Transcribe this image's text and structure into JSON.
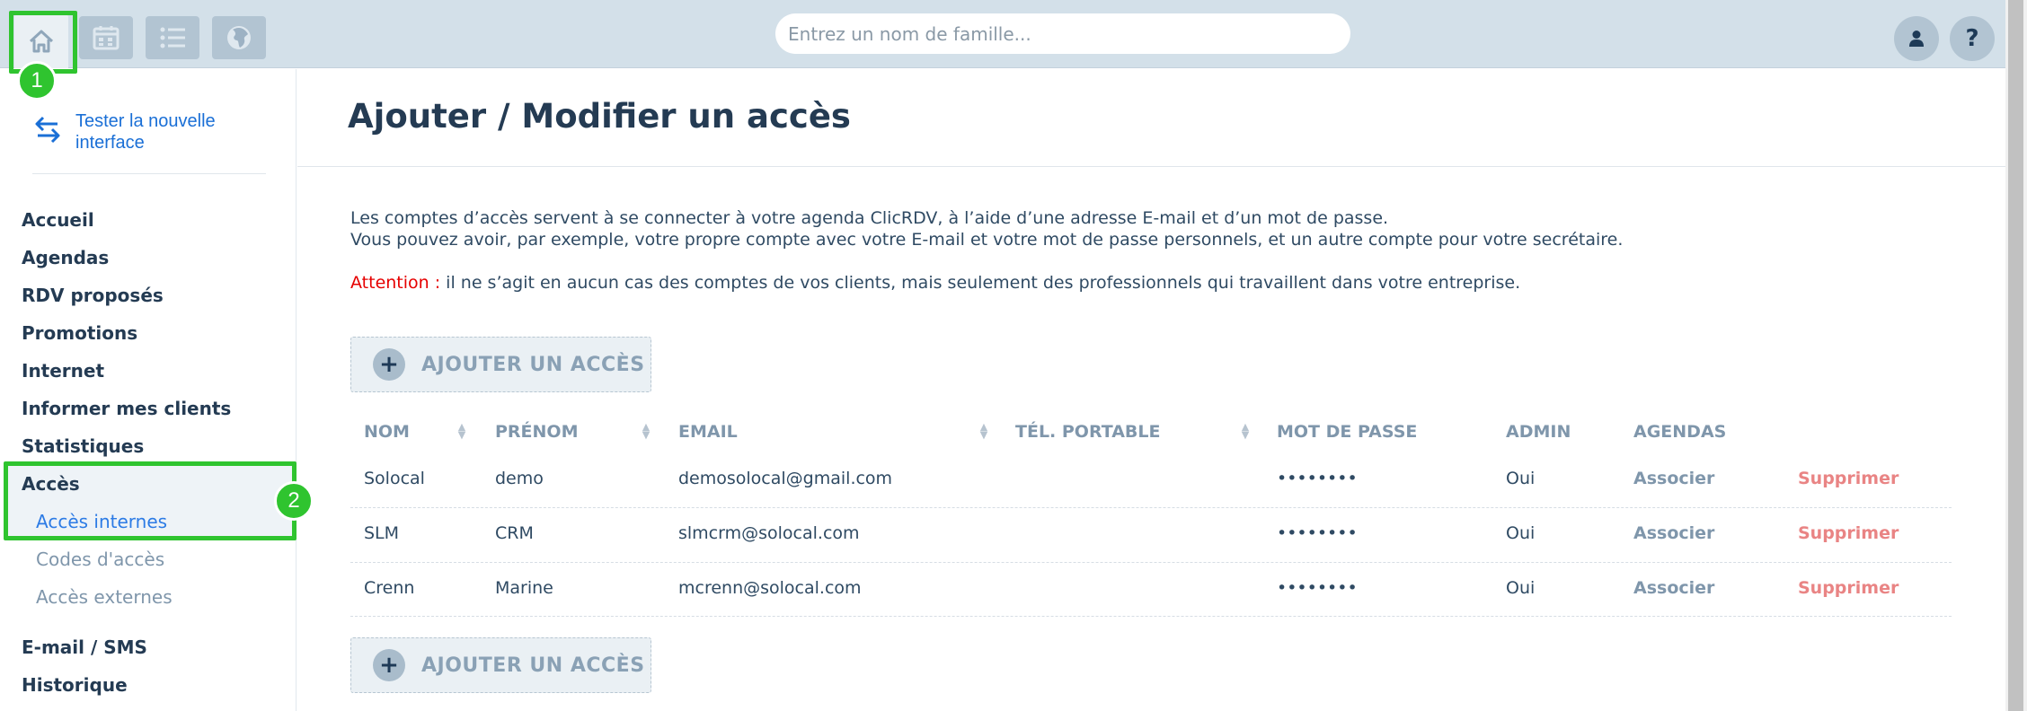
{
  "topbar": {
    "nav_buttons": [
      {
        "icon": "home-icon",
        "active": true
      },
      {
        "icon": "calendar-icon",
        "active": false
      },
      {
        "icon": "list-icon",
        "active": false
      },
      {
        "icon": "globe-icon",
        "active": false
      }
    ],
    "search_placeholder": "Entrez un nom de famille...",
    "user_icon": "user-icon",
    "help_label": "?"
  },
  "sidebar": {
    "try_new_interface": "Tester la nouvelle interface",
    "items": [
      {
        "label": "Accueil"
      },
      {
        "label": "Agendas"
      },
      {
        "label": "RDV proposés"
      },
      {
        "label": "Promotions"
      },
      {
        "label": "Internet"
      },
      {
        "label": "Informer mes clients"
      },
      {
        "label": "Statistiques"
      },
      {
        "label": "Accès"
      },
      {
        "label": "E-mail / SMS"
      },
      {
        "label": "Historique"
      }
    ],
    "sub_items": [
      {
        "label": "Accès internes",
        "active": true
      },
      {
        "label": "Codes d'accès",
        "active": false
      },
      {
        "label": "Accès externes",
        "active": false
      }
    ]
  },
  "highlights": [
    {
      "number": "1"
    },
    {
      "number": "2"
    }
  ],
  "main": {
    "title": "Ajouter / Modifier un accès",
    "intro_line1": "Les comptes d’accès servent à se connecter à votre agenda ClicRDV, à l’aide d’une adresse E-mail et d’un mot de passe.",
    "intro_line2": "Vous pouvez avoir, par exemple, votre propre compte avec votre E-mail et votre mot de passe personnels, et un autre compte pour votre secrétaire.",
    "attention_label": "Attention :",
    "attention_text": " il ne s’agit en aucun cas des comptes de vos clients, mais seulement des professionnels qui travaillent dans votre entreprise.",
    "add_access_label": "AJOUTER UN ACCÈS",
    "table": {
      "headers": [
        "NOM",
        "PRÉNOM",
        "EMAIL",
        "TÉL. PORTABLE",
        "MOT DE PASSE",
        "ADMIN",
        "AGENDAS"
      ],
      "rows": [
        {
          "nom": "Solocal",
          "prenom": "demo",
          "email": "demosolocal@gmail.com",
          "tel": "",
          "password": "••••••••",
          "admin": "Oui",
          "agendas": "Associer",
          "delete": "Supprimer"
        },
        {
          "nom": "SLM",
          "prenom": "CRM",
          "email": "slmcrm@solocal.com",
          "tel": "",
          "password": "••••••••",
          "admin": "Oui",
          "agendas": "Associer",
          "delete": "Supprimer"
        },
        {
          "nom": "Crenn",
          "prenom": "Marine",
          "email": "mcrenn@solocal.com",
          "tel": "",
          "password": "••••••••",
          "admin": "Oui",
          "agendas": "Associer",
          "delete": "Supprimer"
        }
      ]
    }
  },
  "colors": {
    "topbar": "#d3e0e9",
    "accent_link": "#1a6fd6",
    "attention": "#e60000",
    "delete": "#e98484",
    "highlight": "#2fc42f"
  }
}
